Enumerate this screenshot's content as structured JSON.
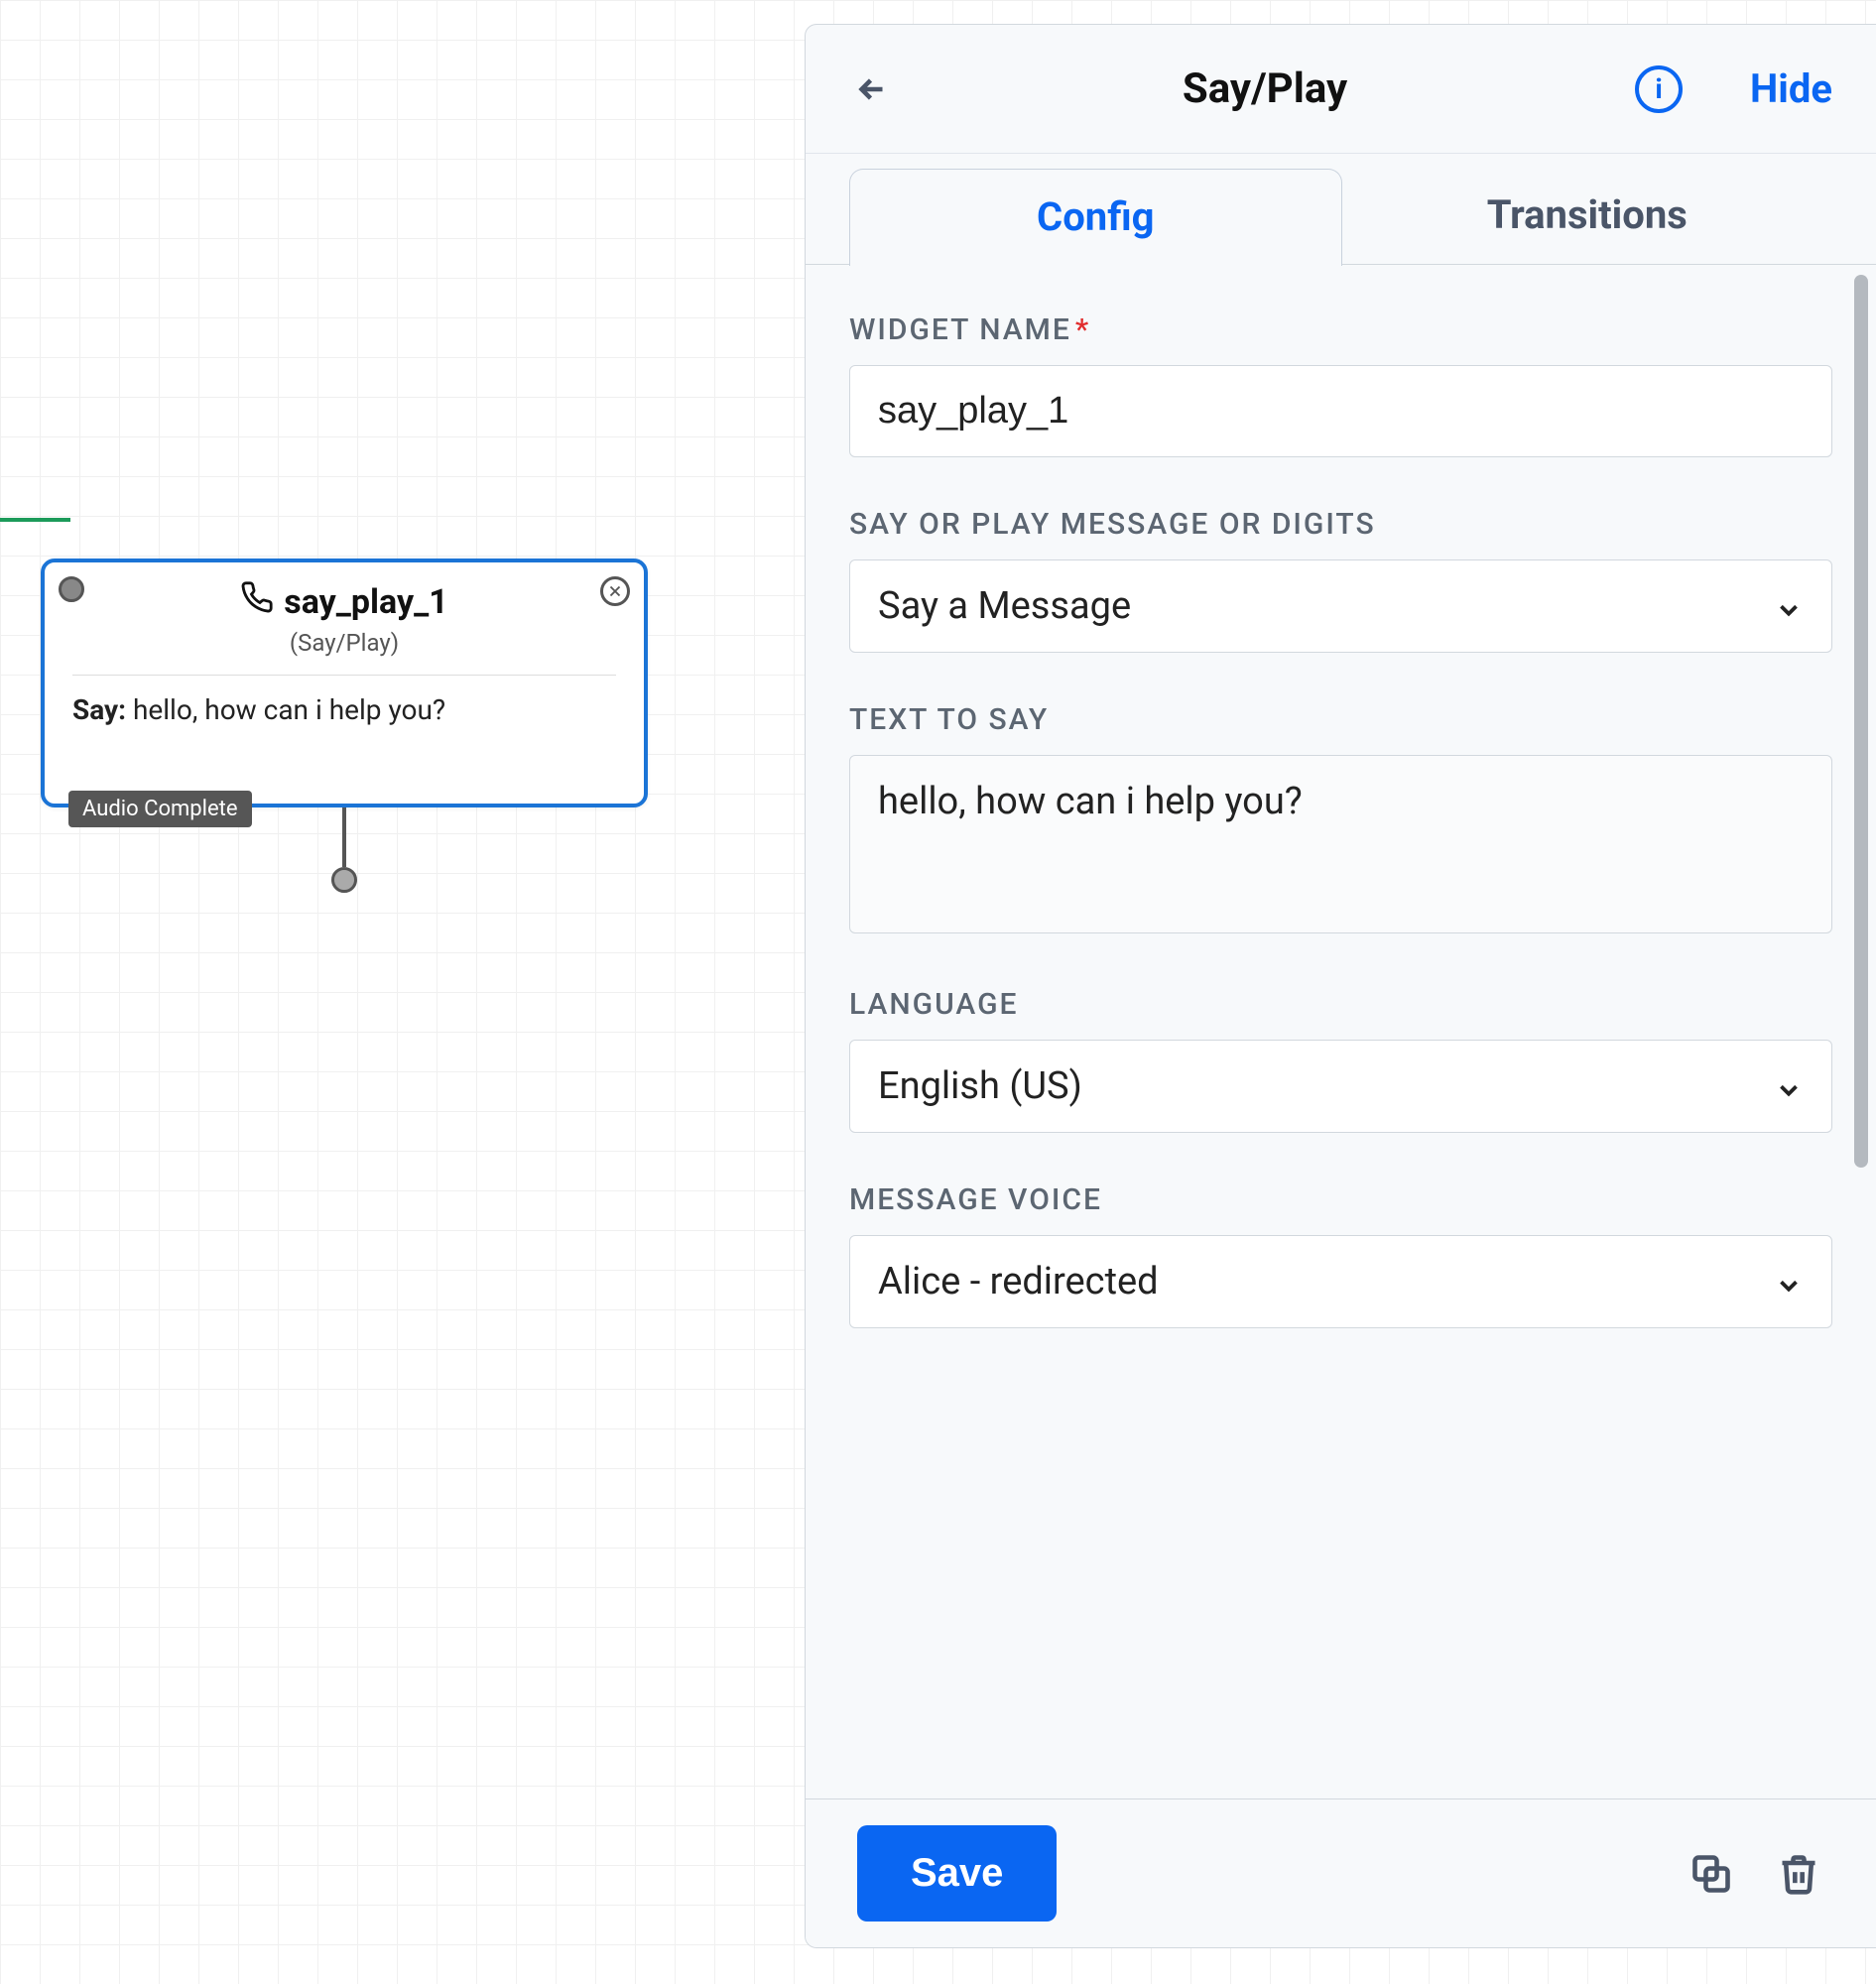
{
  "canvas": {
    "node": {
      "title": "say_play_1",
      "type_label": "(Say/Play)",
      "say_prefix": "Say:",
      "say_text": "hello, how can i help you?",
      "badge": "Audio Complete"
    }
  },
  "panel": {
    "header": {
      "title": "Say/Play",
      "hide_label": "Hide"
    },
    "tabs": {
      "config": "Config",
      "transitions": "Transitions"
    },
    "form": {
      "widget_name_label": "WIDGET NAME",
      "widget_name_value": "say_play_1",
      "say_or_play_label": "SAY OR PLAY MESSAGE OR DIGITS",
      "say_or_play_value": "Say a Message",
      "text_to_say_label": "TEXT TO SAY",
      "text_to_say_value": "hello, how can i help you?",
      "language_label": "LANGUAGE",
      "language_value": "English (US)",
      "message_voice_label": "MESSAGE VOICE",
      "message_voice_value": "Alice - redirected"
    },
    "footer": {
      "save_label": "Save"
    }
  }
}
